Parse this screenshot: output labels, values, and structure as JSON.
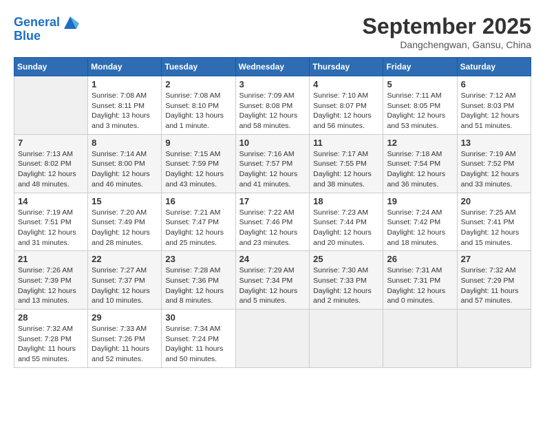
{
  "header": {
    "logo_line1": "General",
    "logo_line2": "Blue",
    "month": "September 2025",
    "location": "Dangchengwan, Gansu, China"
  },
  "days_of_week": [
    "Sunday",
    "Monday",
    "Tuesday",
    "Wednesday",
    "Thursday",
    "Friday",
    "Saturday"
  ],
  "weeks": [
    [
      {
        "day": "",
        "info": ""
      },
      {
        "day": "1",
        "info": "Sunrise: 7:08 AM\nSunset: 8:11 PM\nDaylight: 13 hours\nand 3 minutes."
      },
      {
        "day": "2",
        "info": "Sunrise: 7:08 AM\nSunset: 8:10 PM\nDaylight: 13 hours\nand 1 minute."
      },
      {
        "day": "3",
        "info": "Sunrise: 7:09 AM\nSunset: 8:08 PM\nDaylight: 12 hours\nand 58 minutes."
      },
      {
        "day": "4",
        "info": "Sunrise: 7:10 AM\nSunset: 8:07 PM\nDaylight: 12 hours\nand 56 minutes."
      },
      {
        "day": "5",
        "info": "Sunrise: 7:11 AM\nSunset: 8:05 PM\nDaylight: 12 hours\nand 53 minutes."
      },
      {
        "day": "6",
        "info": "Sunrise: 7:12 AM\nSunset: 8:03 PM\nDaylight: 12 hours\nand 51 minutes."
      }
    ],
    [
      {
        "day": "7",
        "info": "Sunrise: 7:13 AM\nSunset: 8:02 PM\nDaylight: 12 hours\nand 48 minutes."
      },
      {
        "day": "8",
        "info": "Sunrise: 7:14 AM\nSunset: 8:00 PM\nDaylight: 12 hours\nand 46 minutes."
      },
      {
        "day": "9",
        "info": "Sunrise: 7:15 AM\nSunset: 7:59 PM\nDaylight: 12 hours\nand 43 minutes."
      },
      {
        "day": "10",
        "info": "Sunrise: 7:16 AM\nSunset: 7:57 PM\nDaylight: 12 hours\nand 41 minutes."
      },
      {
        "day": "11",
        "info": "Sunrise: 7:17 AM\nSunset: 7:55 PM\nDaylight: 12 hours\nand 38 minutes."
      },
      {
        "day": "12",
        "info": "Sunrise: 7:18 AM\nSunset: 7:54 PM\nDaylight: 12 hours\nand 36 minutes."
      },
      {
        "day": "13",
        "info": "Sunrise: 7:19 AM\nSunset: 7:52 PM\nDaylight: 12 hours\nand 33 minutes."
      }
    ],
    [
      {
        "day": "14",
        "info": "Sunrise: 7:19 AM\nSunset: 7:51 PM\nDaylight: 12 hours\nand 31 minutes."
      },
      {
        "day": "15",
        "info": "Sunrise: 7:20 AM\nSunset: 7:49 PM\nDaylight: 12 hours\nand 28 minutes."
      },
      {
        "day": "16",
        "info": "Sunrise: 7:21 AM\nSunset: 7:47 PM\nDaylight: 12 hours\nand 25 minutes."
      },
      {
        "day": "17",
        "info": "Sunrise: 7:22 AM\nSunset: 7:46 PM\nDaylight: 12 hours\nand 23 minutes."
      },
      {
        "day": "18",
        "info": "Sunrise: 7:23 AM\nSunset: 7:44 PM\nDaylight: 12 hours\nand 20 minutes."
      },
      {
        "day": "19",
        "info": "Sunrise: 7:24 AM\nSunset: 7:42 PM\nDaylight: 12 hours\nand 18 minutes."
      },
      {
        "day": "20",
        "info": "Sunrise: 7:25 AM\nSunset: 7:41 PM\nDaylight: 12 hours\nand 15 minutes."
      }
    ],
    [
      {
        "day": "21",
        "info": "Sunrise: 7:26 AM\nSunset: 7:39 PM\nDaylight: 12 hours\nand 13 minutes."
      },
      {
        "day": "22",
        "info": "Sunrise: 7:27 AM\nSunset: 7:37 PM\nDaylight: 12 hours\nand 10 minutes."
      },
      {
        "day": "23",
        "info": "Sunrise: 7:28 AM\nSunset: 7:36 PM\nDaylight: 12 hours\nand 8 minutes."
      },
      {
        "day": "24",
        "info": "Sunrise: 7:29 AM\nSunset: 7:34 PM\nDaylight: 12 hours\nand 5 minutes."
      },
      {
        "day": "25",
        "info": "Sunrise: 7:30 AM\nSunset: 7:33 PM\nDaylight: 12 hours\nand 2 minutes."
      },
      {
        "day": "26",
        "info": "Sunrise: 7:31 AM\nSunset: 7:31 PM\nDaylight: 12 hours\nand 0 minutes."
      },
      {
        "day": "27",
        "info": "Sunrise: 7:32 AM\nSunset: 7:29 PM\nDaylight: 11 hours\nand 57 minutes."
      }
    ],
    [
      {
        "day": "28",
        "info": "Sunrise: 7:32 AM\nSunset: 7:28 PM\nDaylight: 11 hours\nand 55 minutes."
      },
      {
        "day": "29",
        "info": "Sunrise: 7:33 AM\nSunset: 7:26 PM\nDaylight: 11 hours\nand 52 minutes."
      },
      {
        "day": "30",
        "info": "Sunrise: 7:34 AM\nSunset: 7:24 PM\nDaylight: 11 hours\nand 50 minutes."
      },
      {
        "day": "",
        "info": ""
      },
      {
        "day": "",
        "info": ""
      },
      {
        "day": "",
        "info": ""
      },
      {
        "day": "",
        "info": ""
      }
    ]
  ]
}
